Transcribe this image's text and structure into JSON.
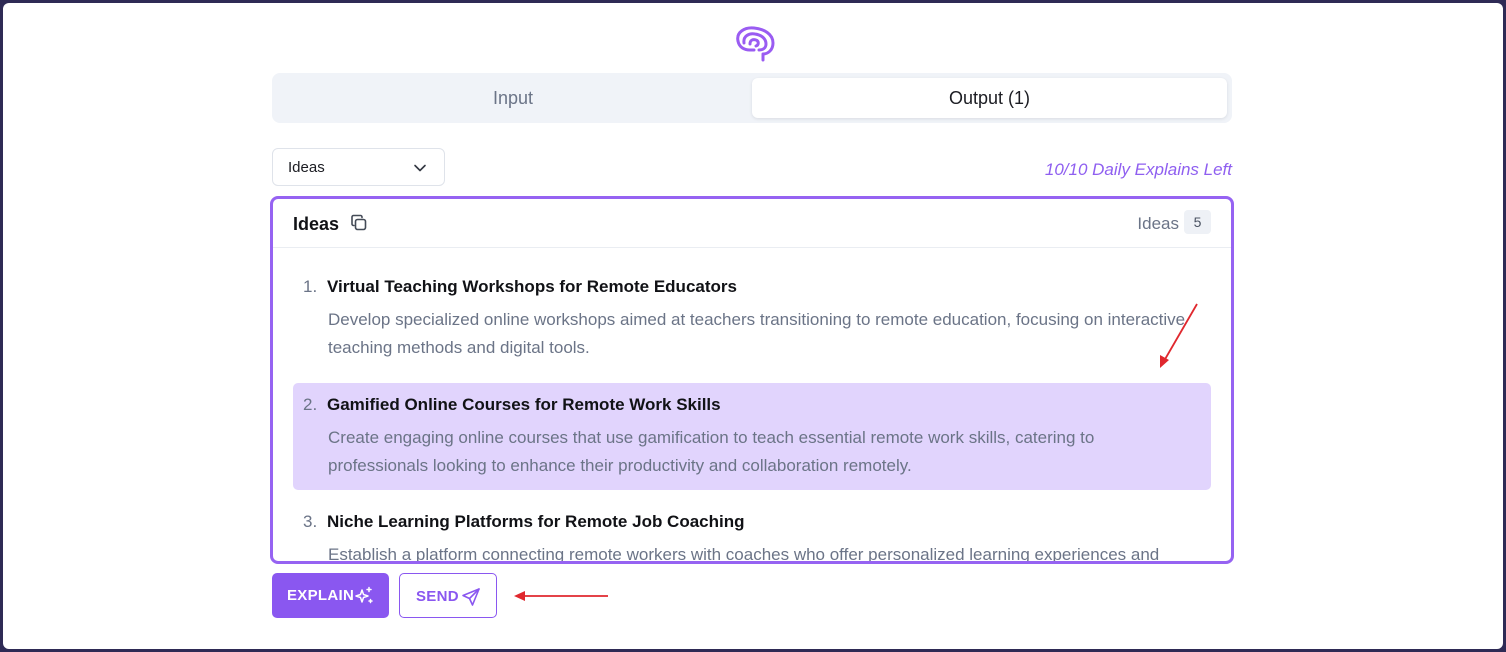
{
  "tabs": [
    {
      "label": "Input",
      "active": false
    },
    {
      "label": "Output (1)",
      "active": true
    }
  ],
  "select": {
    "selected": "Ideas"
  },
  "explains_left": "10/10 Daily Explains Left",
  "panel": {
    "title": "Ideas",
    "count_label": "Ideas",
    "count": "5"
  },
  "ideas": [
    {
      "number": "1.",
      "title": "Virtual Teaching Workshops for Remote Educators",
      "description": "Develop specialized online workshops aimed at teachers transitioning to remote education, focusing on interactive teaching methods and digital tools."
    },
    {
      "number": "2.",
      "title": "Gamified Online Courses for Remote Work Skills",
      "description": "Create engaging online courses that use gamification to teach essential remote work skills, catering to professionals looking to enhance their productivity and collaboration remotely."
    },
    {
      "number": "3.",
      "title": "Niche Learning Platforms for Remote Job Coaching",
      "description": "Establish a platform connecting remote workers with coaches who offer personalized learning experiences and"
    }
  ],
  "buttons": {
    "explain": "EXPLAIN",
    "send": "SEND"
  },
  "colors": {
    "accent": "#8a57f0",
    "panel_border": "#9663f2",
    "highlight": "#e1d4fd",
    "annotation_arrow": "#e0282e"
  },
  "icons": {
    "logo": "brain-logo-icon",
    "select": "chevron-down-icon",
    "copy": "copy-icon",
    "explain": "sparkles-icon",
    "send": "send-icon"
  }
}
